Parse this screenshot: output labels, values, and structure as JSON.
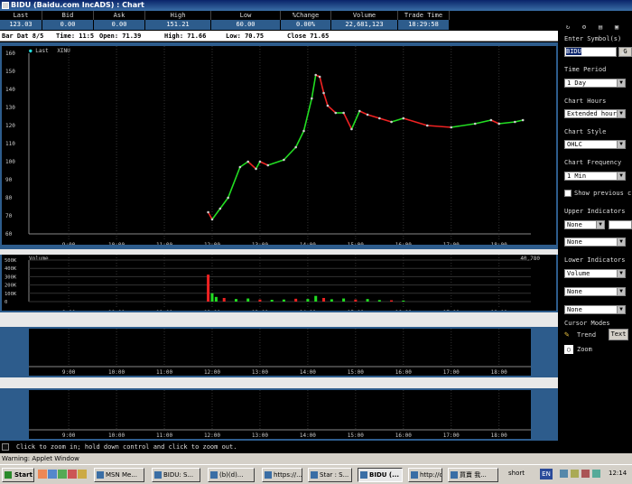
{
  "window": {
    "title": "BIDU (Baidu.com IncADS) : Chart"
  },
  "quote": {
    "headers": [
      "Last",
      "Bid",
      "Ask",
      "High",
      "Low",
      "%Change",
      "Volume",
      "Trade Time"
    ],
    "values": [
      "123.03",
      "0.00",
      "0.00",
      "151.21",
      "60.00",
      "0.00%",
      "22,681,123",
      "18:29:58"
    ]
  },
  "bar_info": {
    "label": "Bar Dat 8/5",
    "time": "Time: 11:5",
    "open": "Open: 71.39",
    "high": "High: 71.66",
    "low": "Low: 70.75",
    "close": "Close 71.65"
  },
  "price_chart": {
    "legend": [
      "Last",
      "XINU"
    ]
  },
  "volume_chart": {
    "legend": "Volume",
    "value": "40,780"
  },
  "panel": {
    "symbol_label": "Enter Symbol(s)",
    "symbol_value": "BIDU",
    "go_button": "G",
    "time_period_label": "Time Period",
    "time_period_value": "1 Day",
    "chart_hours_label": "Chart Hours",
    "chart_hours_value": "Extended hours",
    "chart_style_label": "Chart Style",
    "chart_style_value": "OHLC",
    "chart_frequency_label": "Chart Frequency",
    "chart_frequency_value": "1 Min",
    "show_previous_label": "Show previous c",
    "upper_indicators_label": "Upper Indicators",
    "upper_ind1": "None",
    "upper_ind2": "None",
    "lower_indicators_label": "Lower Indicators",
    "lower_ind1": "Volume",
    "lower_ind2": "None",
    "lower_ind3": "None",
    "cursor_modes_label": "Cursor Modes",
    "trend_label": "Trend",
    "text_button": "Text",
    "zoom_label": "Zoom"
  },
  "status": "Click to zoom in; hold down control and click to zoom out.",
  "warning": "Warning: Applet Window",
  "taskbar": {
    "start": "Start",
    "items": [
      "MSN Me...",
      "BIDU: S...",
      "(b)(d)...",
      "https://...",
      "Star : S...",
      "BIDU (...",
      "http://c...",
      "買賣 我..."
    ],
    "tray": {
      "short": "short",
      "lang": "EN",
      "clock": "12:14"
    }
  },
  "colors": {
    "frame": "#2d5c8c",
    "up": "#22dd22",
    "down": "#ee2222",
    "neutral": "#cccccc"
  },
  "chart_data": [
    {
      "type": "line",
      "title": "",
      "ylabel": "",
      "ylim": [
        60,
        160
      ],
      "yticks": [
        60,
        70,
        80,
        90,
        100,
        110,
        120,
        130,
        140,
        150,
        160
      ],
      "xticks": [
        "9:00",
        "10:00",
        "11:00",
        "12:00",
        "13:00",
        "14:00",
        "15:00",
        "16:00",
        "17:00",
        "18:00"
      ],
      "xlim": [
        "8:10",
        "18:40"
      ],
      "series": [
        {
          "name": "Last",
          "x": [
            "11:55",
            "12:00",
            "12:10",
            "12:20",
            "12:35",
            "12:45",
            "12:55",
            "13:00",
            "13:10",
            "13:30",
            "13:45",
            "13:55",
            "14:05",
            "14:10",
            "14:15",
            "14:20",
            "14:25",
            "14:35",
            "14:45",
            "14:55",
            "15:05",
            "15:15",
            "15:30",
            "15:45",
            "16:00",
            "16:30",
            "17:00",
            "17:30",
            "17:50",
            "18:00",
            "18:20",
            "18:30"
          ],
          "values": [
            72,
            68,
            74,
            80,
            97,
            100,
            96,
            100,
            98,
            101,
            108,
            117,
            135,
            148,
            147,
            138,
            131,
            127,
            127,
            118,
            128,
            126,
            124,
            122,
            124,
            120,
            119,
            121,
            123,
            121,
            122,
            123
          ]
        }
      ]
    },
    {
      "type": "bar",
      "title": "",
      "ylabel": "",
      "ylim": [
        0,
        800000
      ],
      "yticks": [
        "500K",
        "400K",
        "300K",
        "200K",
        "100K",
        "0"
      ],
      "xticks": [
        "9:00",
        "10:00",
        "11:00",
        "12:00",
        "13:00",
        "14:00",
        "15:00",
        "16:00",
        "17:00",
        "18:00"
      ],
      "series": [
        {
          "name": "Volume",
          "x": [
            "11:55",
            "12:00",
            "12:05",
            "12:15",
            "12:30",
            "12:45",
            "13:00",
            "13:15",
            "13:30",
            "13:45",
            "14:00",
            "14:10",
            "14:20",
            "14:30",
            "14:45",
            "15:00",
            "15:15",
            "15:30",
            "15:45",
            "16:00"
          ],
          "values": [
            520000,
            160000,
            90000,
            70000,
            50000,
            60000,
            40000,
            35000,
            40000,
            55000,
            50000,
            110000,
            70000,
            45000,
            60000,
            40000,
            50000,
            30000,
            25000,
            20000
          ]
        }
      ]
    }
  ]
}
